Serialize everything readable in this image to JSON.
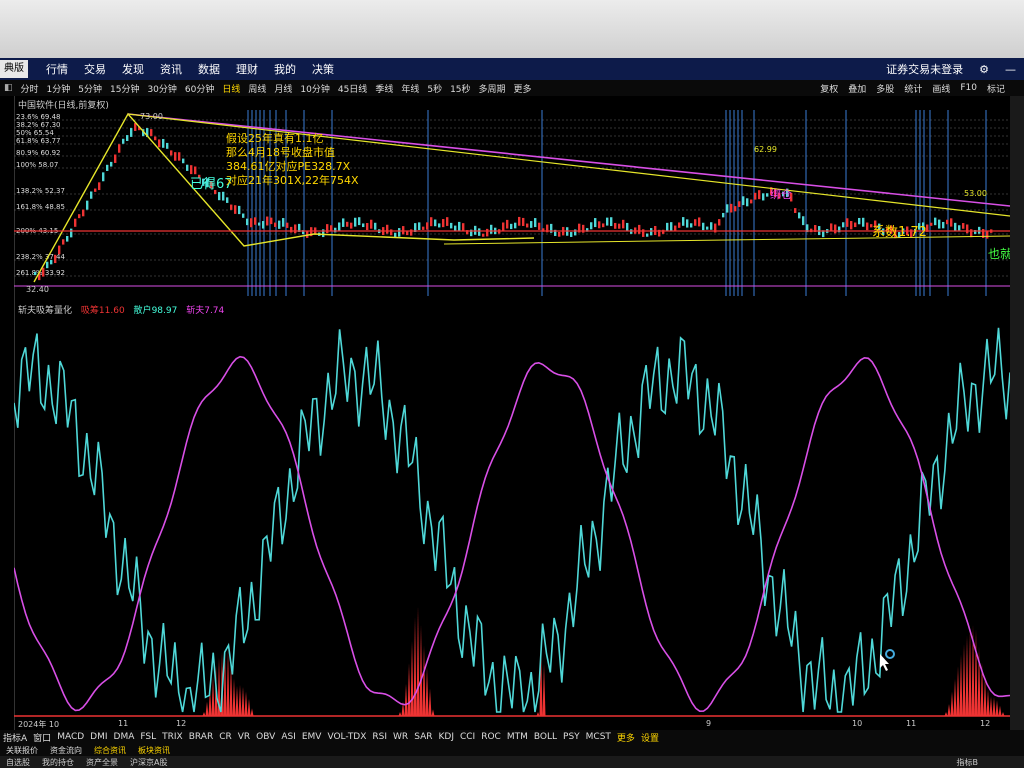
{
  "menubar": {
    "version": "典版",
    "items": [
      "行情",
      "交易",
      "发现",
      "资讯",
      "数据",
      "理财",
      "我的",
      "决策"
    ],
    "login": "证券交易未登录"
  },
  "toolbar": {
    "periods": [
      "分时",
      "1分钟",
      "5分钟",
      "15分钟",
      "30分钟",
      "60分钟",
      "日线",
      "周线",
      "月线",
      "10分钟",
      "45日线",
      "季线",
      "年线",
      "5秒",
      "15秒",
      "多周期",
      "更多"
    ],
    "active": "日线",
    "right": [
      "复权",
      "叠加",
      "多股",
      "统计",
      "画线",
      "F10",
      "标记"
    ]
  },
  "chart": {
    "title": "中国软件(日线,前复权)",
    "high_label": "73.00",
    "low_label": "32.40",
    "fib_labels": [
      "23.6% 69.48",
      "38.2% 67.30",
      "50% 65.54",
      "61.8% 63.77",
      "80.9% 60.92",
      "100% 58.07",
      "138.2% 52.37",
      "161.8% 48.85",
      "200% 43.15",
      "238.2% 37.44",
      "261.8% 33.92"
    ],
    "price_labels": [
      "62.99",
      "53.00"
    ],
    "annotation_lines": [
      "假设25年真有1.1亿",
      "那么4月18号收盘市值",
      "384.61亿对应PE328.7X",
      "对应21年301X,22年754X"
    ],
    "coef_text": "系数1.72",
    "side_text": "也就是",
    "misc": [
      "绑仓",
      "已得67"
    ]
  },
  "indicator": {
    "name": "斩夫吸筹量化",
    "vals": [
      {
        "label": "吸筹",
        "value": "11.60"
      },
      {
        "label": "散户",
        "value": "98.97"
      },
      {
        "label": "斩夫",
        "value": "7.74"
      }
    ]
  },
  "xaxis": [
    "2024年 10",
    "11",
    "12",
    "9",
    "10",
    "11",
    "12"
  ],
  "tabs": [
    "指标A",
    "窗口",
    "MACD",
    "DMI",
    "DMA",
    "FSL",
    "TRIX",
    "BRAR",
    "CR",
    "VR",
    "OBV",
    "ASI",
    "EMV",
    "VOL-TDX",
    "RSI",
    "WR",
    "SAR",
    "KDJ",
    "CCI",
    "ROC",
    "MTM",
    "BOLL",
    "PSY",
    "MCST",
    "更多",
    "设置"
  ],
  "tabs2": [
    "关联报价",
    "资金流向",
    "综合资讯",
    "板块资讯"
  ],
  "statusbar": {
    "left": [
      "自选股",
      "我的持仓",
      "资产全景",
      "沪深京A股"
    ],
    "right": "指标B"
  },
  "colors": {
    "menubar": "#0d1b4a",
    "cyan": "#4fd8d8",
    "magenta": "#d84fe6",
    "red": "#e33",
    "yellow": "#ffd700"
  }
}
